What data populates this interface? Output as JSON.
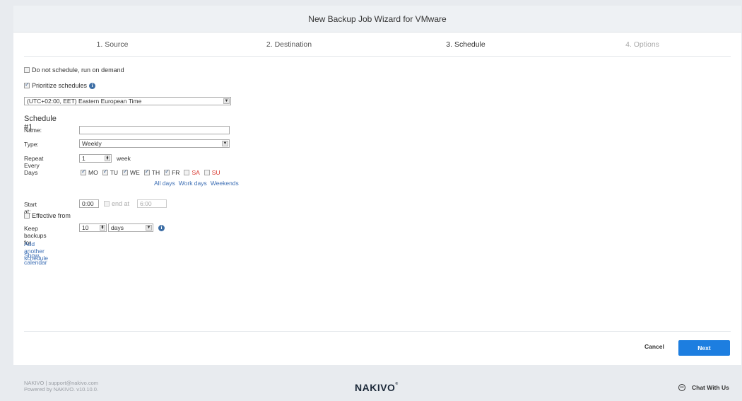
{
  "window": {
    "title": "New Backup Job Wizard for VMware"
  },
  "steps": [
    {
      "label": "1. Source"
    },
    {
      "label": "2. Destination"
    },
    {
      "label": "3. Schedule"
    },
    {
      "label": "4. Options"
    }
  ],
  "options": {
    "do_not_schedule": {
      "label": "Do not schedule, run on demand",
      "checked": false
    },
    "prioritize": {
      "label": "Prioritize schedules",
      "checked": true
    }
  },
  "timezone": {
    "value": "(UTC+02:00, EET) Eastern European Time"
  },
  "schedule": {
    "title": "Schedule #1",
    "name_label": "Name:",
    "name_value": "",
    "type_label": "Type:",
    "type_value": "Weekly",
    "repeat_label": "Repeat Every",
    "repeat_value": "1",
    "repeat_unit": "week",
    "days_label": "Days",
    "days": [
      {
        "label": "MO",
        "checked": true
      },
      {
        "label": "TU",
        "checked": true
      },
      {
        "label": "WE",
        "checked": true
      },
      {
        "label": "TH",
        "checked": true
      },
      {
        "label": "FR",
        "checked": true
      },
      {
        "label": "SA",
        "checked": false
      },
      {
        "label": "SU",
        "checked": false
      }
    ],
    "day_links": {
      "all": "All days",
      "work": "Work days",
      "weekends": "Weekends"
    },
    "start_label": "Start at:",
    "start_value": "0:00",
    "end_label": "end at",
    "end_value": "6:00",
    "effective_label": "Effective from",
    "keep_label": "Keep backups for",
    "keep_value": "10",
    "keep_unit": "days"
  },
  "links": {
    "add_schedule": "Add another schedule",
    "show_calendar": "Show calendar"
  },
  "buttons": {
    "cancel": "Cancel",
    "next": "Next"
  },
  "footer": {
    "line1": "NAKIVO | support@nakivo.com",
    "line2": "Powered by NAKIVO. v10.10.0.",
    "logo": "NAKIVO",
    "logo_mark": "®",
    "chat": "Chat With Us"
  },
  "colors": {
    "accent": "#1d7ee0",
    "link": "#3c6eb4",
    "weekend": "#d9342b"
  }
}
